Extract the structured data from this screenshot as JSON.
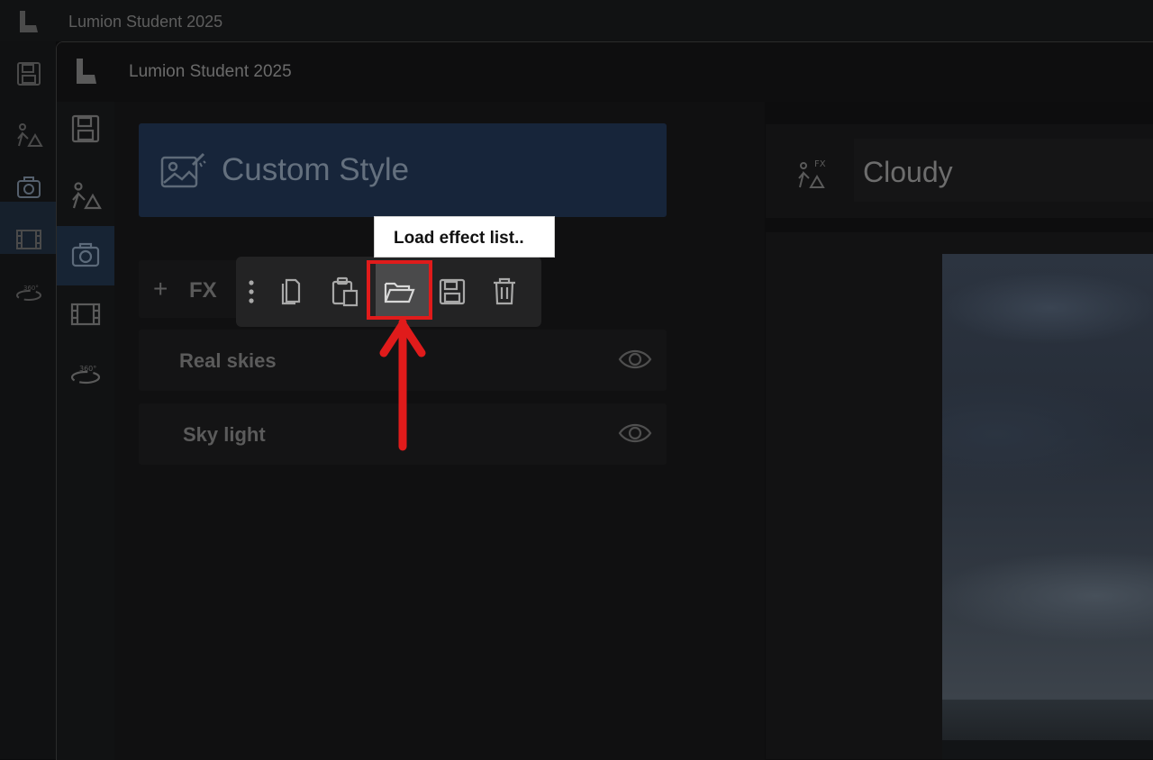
{
  "app": {
    "back_title": "Lumion Student 2025",
    "front_title": "Lumion Student 2025"
  },
  "sidebar": {
    "items": [
      {
        "name": "save",
        "icon": "floppy-disk-icon"
      },
      {
        "name": "build",
        "icon": "build-mode-icon"
      },
      {
        "name": "photo",
        "icon": "camera-icon",
        "active": true
      },
      {
        "name": "movie",
        "icon": "film-icon"
      },
      {
        "name": "panorama",
        "icon": "360-icon"
      }
    ]
  },
  "left_panel": {
    "style_title": "Custom Style",
    "fx_plus": "+",
    "fx_label": "FX",
    "effects": [
      {
        "label": "Real skies"
      },
      {
        "label": "Sky light"
      }
    ]
  },
  "toolbar": {
    "buttons": [
      "more-icon",
      "copy-icon",
      "paste-icon",
      "open-folder-icon",
      "save-icon",
      "delete-icon"
    ],
    "tooltip": "Load effect list.."
  },
  "right_panel": {
    "title": "Cloudy"
  },
  "colors": {
    "accent_blue": "#17253a",
    "highlight_red": "#e01b1b"
  }
}
